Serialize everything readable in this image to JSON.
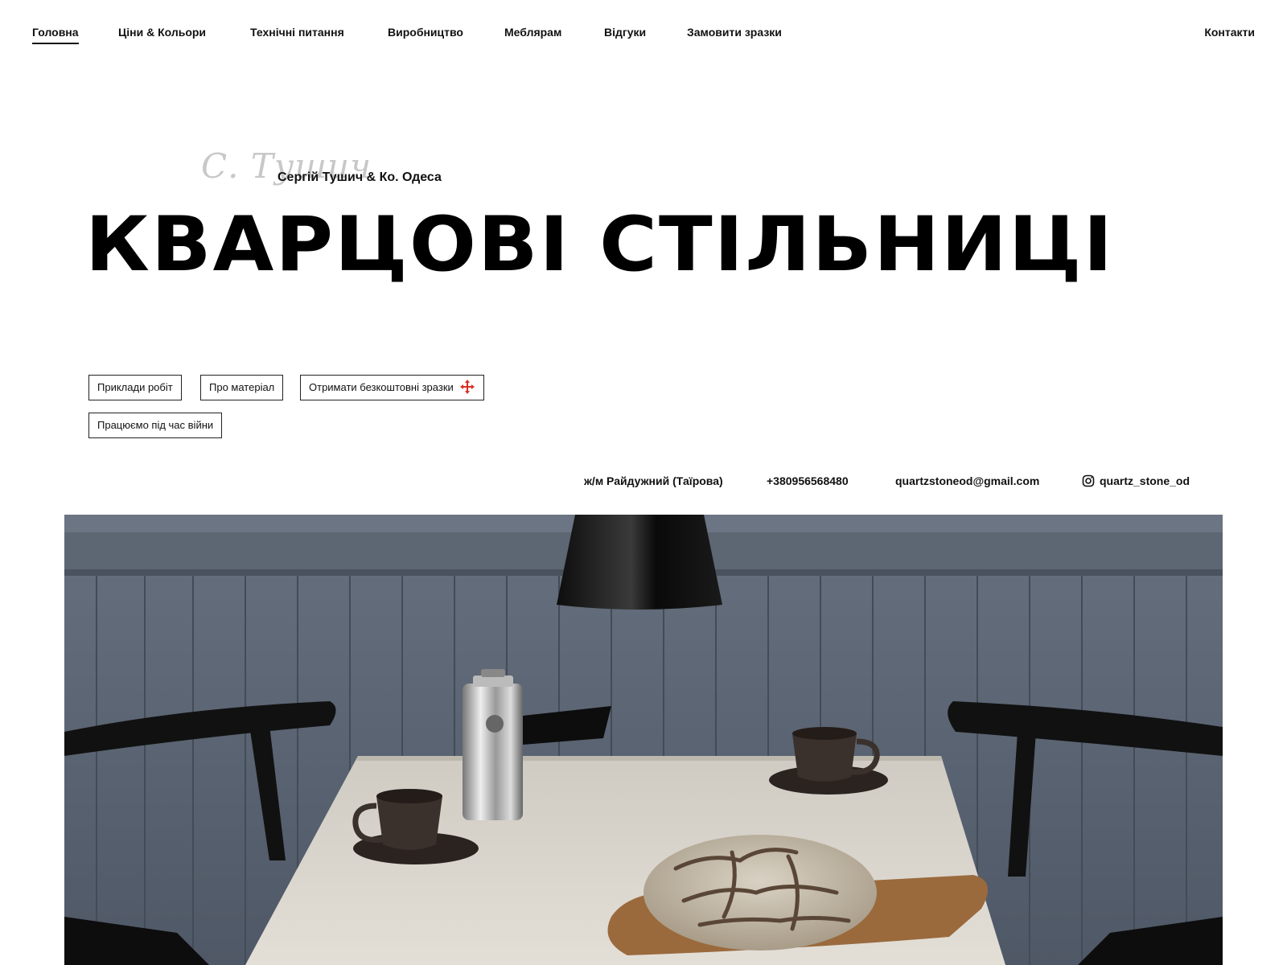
{
  "nav": {
    "items": [
      {
        "label": "Головна",
        "active": true
      },
      {
        "label": "Ціни & Кольори"
      },
      {
        "label": "Технічні питання"
      },
      {
        "label": "Виробництво"
      },
      {
        "label": "Меблярам"
      },
      {
        "label": "Відгуки"
      },
      {
        "label": "Замовити зразки"
      }
    ],
    "contacts_label": "Контакти"
  },
  "hero": {
    "signature": "С. Тушич",
    "subtitle": "Сергій Тушич & Ко. Одеса",
    "title": "КВАРЦОВІ СТІЛЬНИЦІ"
  },
  "buttons": {
    "examples": "Приклади робіт",
    "about": "Про матеріал",
    "samples": "Отримати безкоштовні зразки",
    "war": "Працюємо під час війни"
  },
  "contact_bar": {
    "address": "ж/м Райдужний (Таїрова)",
    "phone": "+380956568480",
    "email": "quartzstoneod@gmail.com",
    "instagram": "quartz_stone_od"
  },
  "colors": {
    "accent_red": "#d93025",
    "wall": "#5a6270",
    "countertop": "#d8d4cc"
  }
}
